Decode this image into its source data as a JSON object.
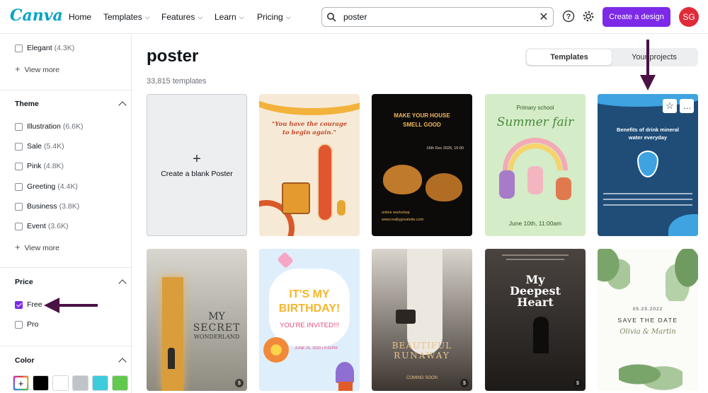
{
  "brand": {
    "logo_text": "Canva"
  },
  "nav": {
    "home": "Home",
    "templates": "Templates",
    "features": "Features",
    "learn": "Learn",
    "pricing": "Pricing"
  },
  "search": {
    "query": "poster",
    "icon": "search-icon",
    "clear_icon": "close-icon"
  },
  "header": {
    "help_icon": "help-icon",
    "settings_icon": "gear-icon",
    "create_label": "Create a design",
    "avatar_initials": "SG",
    "accent": "#7d2ae8",
    "avatar_color": "#e02b3a"
  },
  "sidebar": {
    "style": {
      "items": [
        {
          "label": "Elegant",
          "count": "(4.3K)"
        }
      ],
      "view_more": "View more"
    },
    "theme": {
      "title": "Theme",
      "items": [
        {
          "label": "Illustration",
          "count": "(6.6K)"
        },
        {
          "label": "Sale",
          "count": "(5.4K)"
        },
        {
          "label": "Pink",
          "count": "(4.8K)"
        },
        {
          "label": "Greeting",
          "count": "(4.4K)"
        },
        {
          "label": "Business",
          "count": "(3.8K)"
        },
        {
          "label": "Event",
          "count": "(3.6K)"
        }
      ],
      "view_more": "View more"
    },
    "price": {
      "title": "Price",
      "items": [
        {
          "label": "Free",
          "checked": true
        },
        {
          "label": "Pro",
          "checked": false
        }
      ]
    },
    "color": {
      "title": "Color",
      "swatches": [
        "#ffffff",
        "#000000",
        "#ffffff",
        "#c0c4c8",
        "#3ecbdc",
        "#63c94e"
      ]
    }
  },
  "main": {
    "title": "poster",
    "count": "33,815 templates",
    "tabs": [
      {
        "label": "Templates",
        "active": true
      },
      {
        "label": "Your projects",
        "active": false
      }
    ],
    "blank_card": {
      "plus": "+",
      "label": "Create a blank Poster"
    },
    "templates": [
      {
        "lines": [
          "\"You have the courage",
          "to begin again.\""
        ]
      },
      {
        "lines": [
          "MAKE YOUR HOUSE",
          "SMELL GOOD",
          "16th Dec 2025, 15:00",
          "online workshop",
          "www.reallygreatsite.com"
        ]
      },
      {
        "lines": [
          "Primary school",
          "Summer fair",
          "June 10th, 11:00am"
        ]
      },
      {
        "lines": [
          "Benefits of drink mineral",
          "water everyday"
        ]
      },
      {
        "lines": [
          "MY",
          "SECRET",
          "WONDERLAND"
        ]
      },
      {
        "lines": [
          "IT'S MY",
          "BIRTHDAY!",
          "YOU'RE INVITED!!!",
          "JUNE 25, 2020 | 6:00PM"
        ]
      },
      {
        "lines": [
          "BEAUTIFUL",
          "RUNAWAY",
          "COMING SOON"
        ]
      },
      {
        "lines": [
          "My",
          "Deepest",
          "Heart"
        ]
      },
      {
        "lines": [
          "05.25.2022",
          "SAVE THE DATE",
          "Olivia & Martin"
        ]
      }
    ]
  }
}
